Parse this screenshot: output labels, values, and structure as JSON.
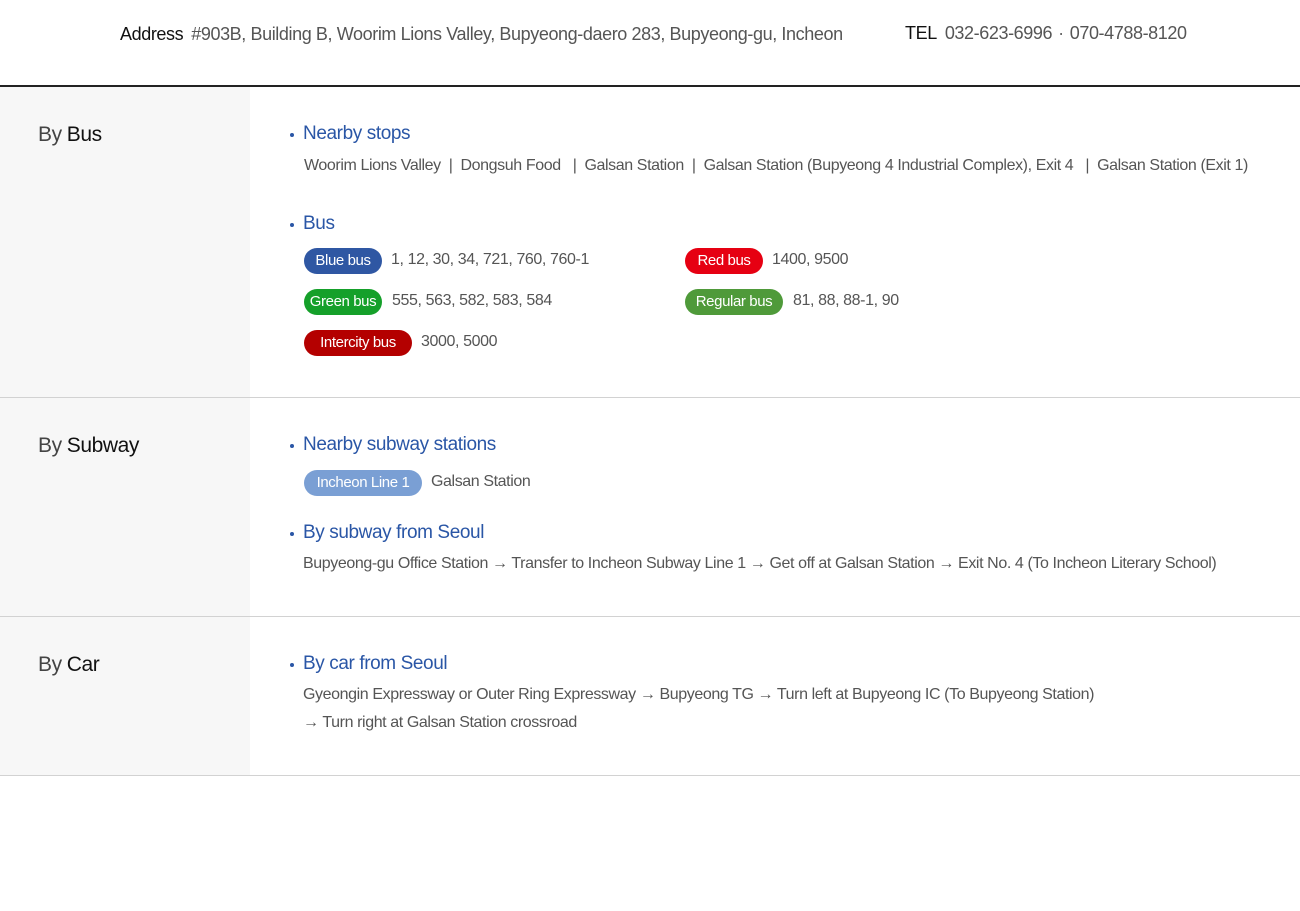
{
  "info": {
    "address_label": "Address",
    "address": "#903B, Building B, Woorim Lions Valley, Bupyeong-daero 283, Bupyeong-gu, Incheon",
    "tel_label": "TEL",
    "tel_1": "032-623-6996",
    "tel_sep": "·",
    "tel_2": "070-4788-8120"
  },
  "bus": {
    "by": "By",
    "title": "Bus",
    "stops_heading": "Nearby stops",
    "stop_sep": "|",
    "stops": [
      "Woorim Lions Valley",
      "Dongsuh Food",
      "Galsan Station",
      "Galsan Station (Bupyeong 4 Industrial Complex), Exit 4",
      "Galsan Station (Exit 1)"
    ],
    "bus_heading": "Bus",
    "types": [
      {
        "label": "Blue bus",
        "routes": "1, 12, 30, 34, 721, 760, 760-1",
        "color": "#2f57a3"
      },
      {
        "label": "Red bus",
        "routes": "1400, 9500",
        "color": "#e60012"
      },
      {
        "label": "Green bus",
        "routes": "555, 563, 582, 583, 584",
        "color": "#15a02a"
      },
      {
        "label": "Regular bus",
        "routes": "81, 88, 88-1, 90",
        "color": "#4f9a3a"
      },
      {
        "label": "Intercity bus",
        "routes": "3000, 5000",
        "color": "#b40000"
      }
    ]
  },
  "subway": {
    "by": "By",
    "title": "Subway",
    "stations_heading": "Nearby subway stations",
    "line_badge": "Incheon Line 1",
    "line_color": "#7a9fd4",
    "station": "Galsan Station",
    "seoul_heading": "By subway from Seoul",
    "route": "Bupyeong-gu Office Station → Transfer to Incheon Subway Line 1 → Get off at Galsan Station → Exit No. 4 (To Incheon Literary School)"
  },
  "car": {
    "by": "By",
    "title": "Car",
    "seoul_heading": "By car from Seoul",
    "route_line1": "Gyeongin Expressway or Outer Ring Expressway → Bupyeong TG → Turn left at Bupyeong IC (To Bupyeong Station)",
    "route_line2": "→ Turn right at Galsan Station crossroad"
  },
  "colors": {
    "accent": "#2a56a6",
    "side_bg": "#f7f7f7",
    "divider": "#d2d2d2"
  }
}
